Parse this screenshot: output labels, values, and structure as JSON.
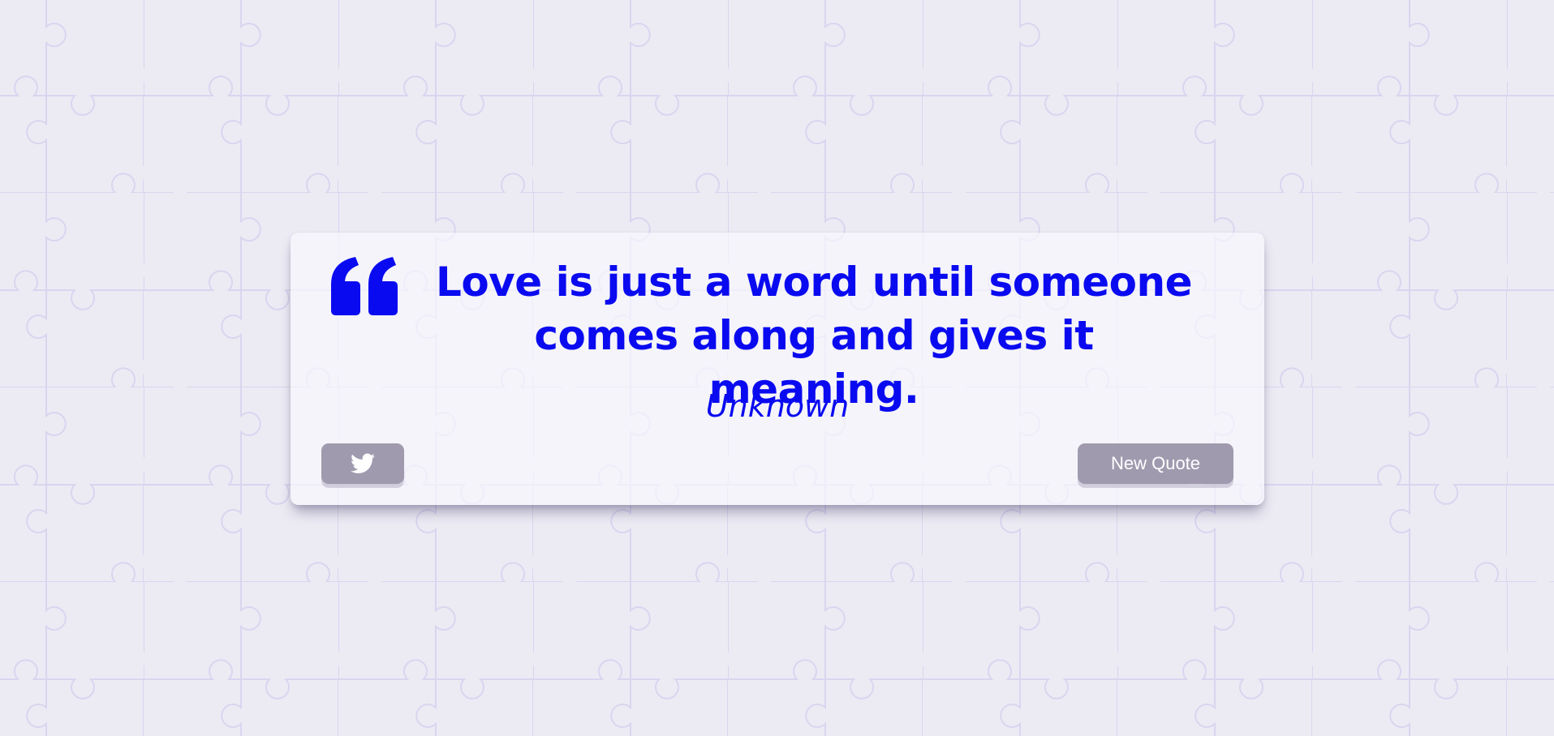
{
  "colors": {
    "background": "#ecebf4",
    "pattern_stroke": "#d9d5ef",
    "card": "#f5f4fa",
    "quote_text": "#0a0af0",
    "button": "#a09aaf",
    "button_text": "#ffffff"
  },
  "quote": {
    "icon": "quote-left-icon",
    "text": "Love is just a word until someone comes along and gives it meaning.",
    "author": "Unknown"
  },
  "buttons": {
    "twitter_icon": "twitter-icon",
    "new_quote_label": "New Quote"
  }
}
